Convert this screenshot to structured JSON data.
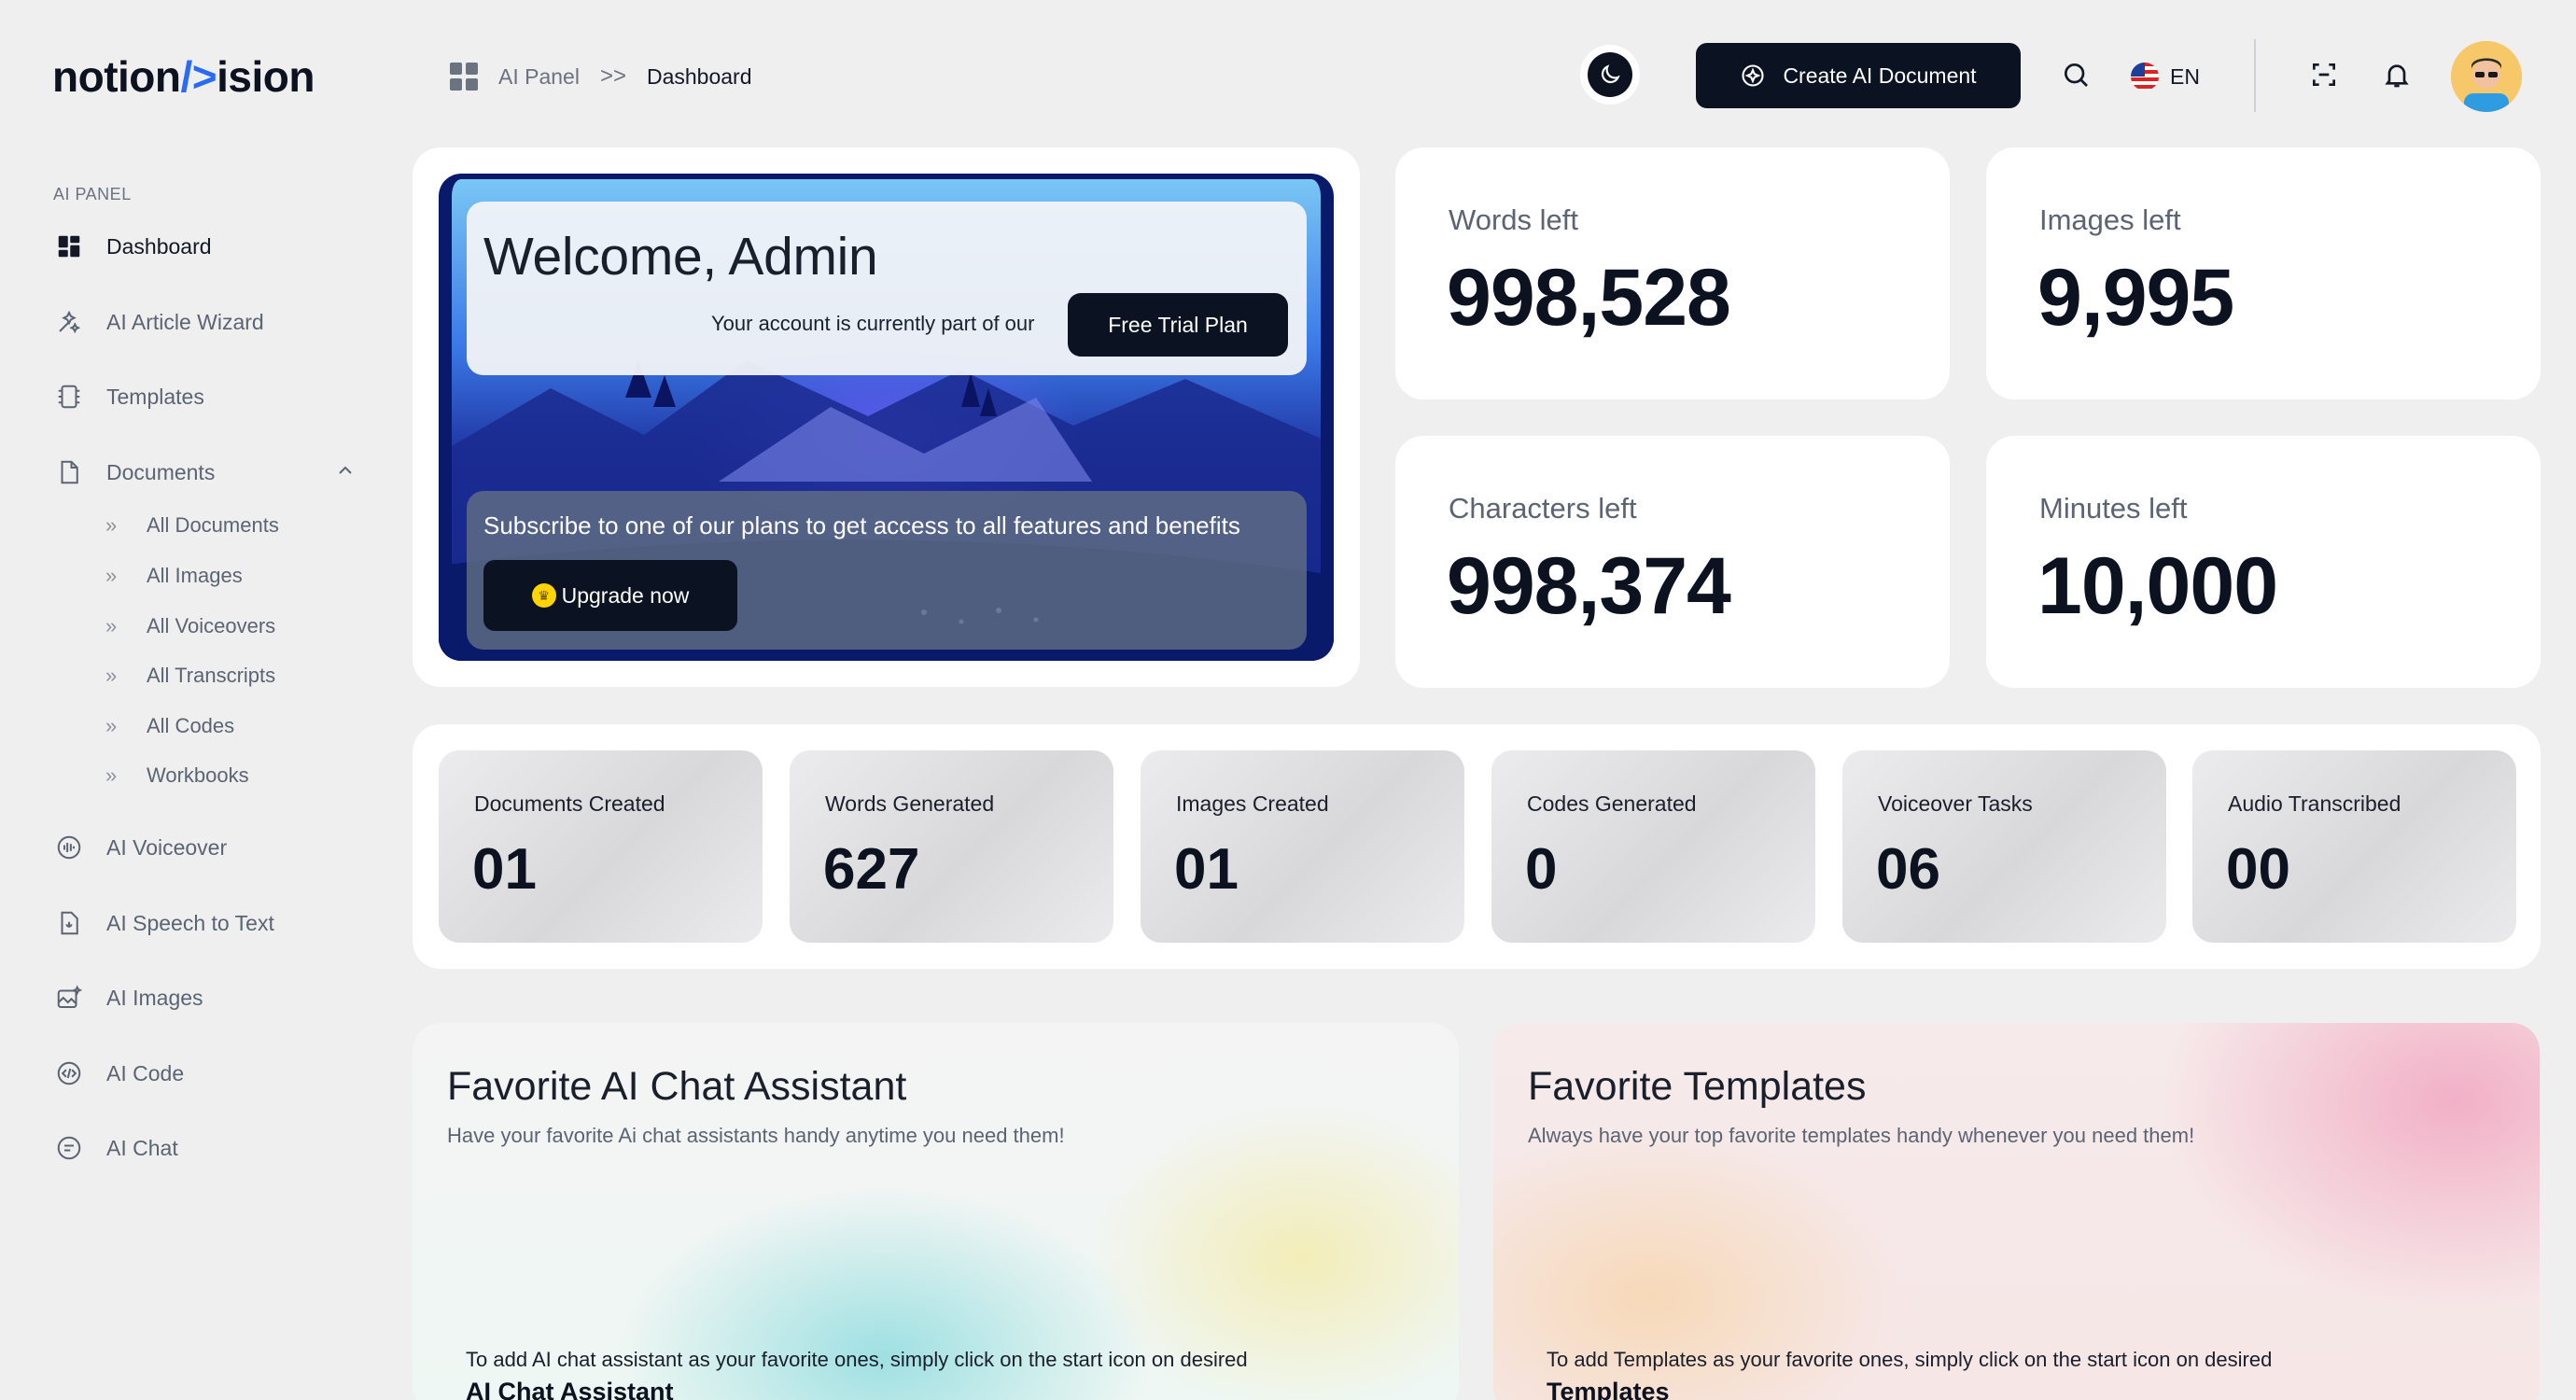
{
  "header": {
    "logo_part1": "notion",
    "logo_part2": "/>",
    "logo_part3": "ision",
    "breadcrumb_parent": "AI Panel",
    "breadcrumb_separator": ">>",
    "breadcrumb_current": "Dashboard",
    "create_button_label": "Create AI Document",
    "language": "EN"
  },
  "sidebar": {
    "section_label": "AI PANEL",
    "items": [
      {
        "label": "Dashboard",
        "icon": "dashboard-icon"
      },
      {
        "label": "AI Article Wizard",
        "icon": "wizard-icon"
      },
      {
        "label": "Templates",
        "icon": "templates-icon"
      },
      {
        "label": "Documents",
        "icon": "document-icon"
      },
      {
        "label": "AI Voiceover",
        "icon": "voiceover-icon"
      },
      {
        "label": "AI Speech to Text",
        "icon": "speech-to-text-icon"
      },
      {
        "label": "AI Images",
        "icon": "images-icon"
      },
      {
        "label": "AI Code",
        "icon": "code-icon"
      },
      {
        "label": "AI Chat",
        "icon": "chat-icon"
      }
    ],
    "documents_sub": [
      "All Documents",
      "All Images",
      "All Voiceovers",
      "All Transcripts",
      "All Codes",
      "Workbooks"
    ]
  },
  "welcome": {
    "title": "Welcome, Admin",
    "account_text": "Your account is currently part of our",
    "plan_button": "Free Trial Plan",
    "subscribe_text": "Subscribe to one of our plans to get access to all features and benefits",
    "upgrade_button": "Upgrade now"
  },
  "stats": [
    {
      "label": "Words left",
      "value": "998,528"
    },
    {
      "label": "Images left",
      "value": "9,995"
    },
    {
      "label": "Characters left",
      "value": "998,374"
    },
    {
      "label": "Minutes left",
      "value": "10,000"
    }
  ],
  "metrics": [
    {
      "label": "Documents Created",
      "value": "01"
    },
    {
      "label": "Words Generated",
      "value": "627"
    },
    {
      "label": "Images Created",
      "value": "01"
    },
    {
      "label": "Codes Generated",
      "value": "0"
    },
    {
      "label": "Voiceover Tasks",
      "value": "06"
    },
    {
      "label": "Audio Transcribed",
      "value": "00"
    }
  ],
  "favorites": {
    "chat": {
      "title": "Favorite AI Chat Assistant",
      "description": "Have your favorite Ai chat assistants handy anytime you need them!",
      "hint": "To add AI chat assistant as your favorite ones, simply click on the start icon on desired",
      "strong": "AI Chat Assistant"
    },
    "templates": {
      "title": "Favorite Templates",
      "description": "Always have your top favorite templates handy whenever you need them!",
      "hint": "To add Templates as your favorite ones, simply click on the start icon on desired",
      "strong": "Templates"
    }
  },
  "colors": {
    "accent": "#2a6bf2",
    "dark_button": "#0b1322",
    "page_bg": "#efeff0"
  }
}
